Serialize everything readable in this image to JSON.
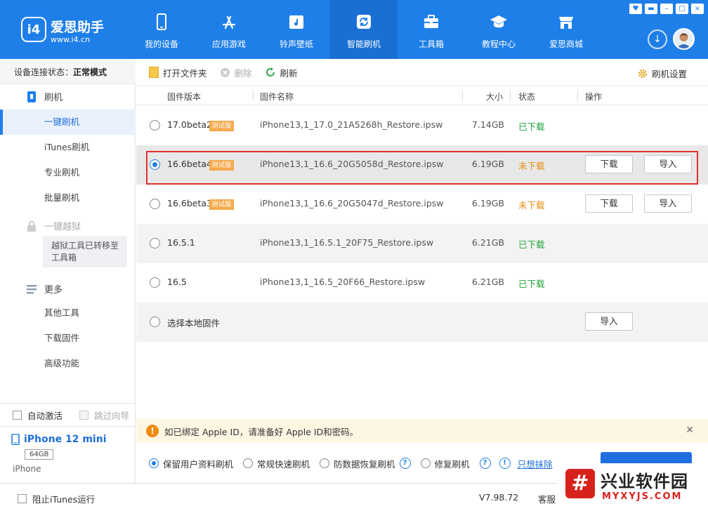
{
  "window": {
    "logo_mark": "i4",
    "app_name": "爱思助手",
    "app_url": "www.i4.cn",
    "controls": [
      "♥",
      "▬",
      "–",
      "□",
      "×"
    ]
  },
  "nav": [
    {
      "label": "我的设备",
      "icon": "phone-icon"
    },
    {
      "label": "应用游戏",
      "icon": "app-store-icon"
    },
    {
      "label": "铃声壁纸",
      "icon": "music-icon"
    },
    {
      "label": "智能刷机",
      "icon": "flash-icon",
      "active": true
    },
    {
      "label": "工具箱",
      "icon": "toolbox-icon"
    },
    {
      "label": "教程中心",
      "icon": "graduation-cap-icon"
    },
    {
      "label": "爱思商城",
      "icon": "shop-icon"
    }
  ],
  "sidebar": {
    "conn_label": "设备连接状态：",
    "conn_value": "正常模式",
    "flash_section": "刷机",
    "items": [
      "一键刷机",
      "iTunes刷机",
      "专业刷机",
      "批量刷机"
    ],
    "jailbreak_section": "一键越狱",
    "jailbreak_note": "越狱工具已转移至工具箱",
    "more_section": "更多",
    "more_items": [
      "其他工具",
      "下载固件",
      "高级功能"
    ],
    "auto_activate": "自动激活",
    "skip_guide": "跳过向导"
  },
  "device": {
    "name": "iPhone 12 mini",
    "storage": "64GB",
    "model": "iPhone"
  },
  "toolbar": {
    "open_folder": "打开文件夹",
    "delete": "删除",
    "refresh": "刷新",
    "settings": "刷机设置"
  },
  "table": {
    "headers": {
      "version": "固件版本",
      "name": "固件名称",
      "size": "大小",
      "status": "状态",
      "action": "操作"
    },
    "rows": [
      {
        "version": "17.0beta2",
        "beta": "测试版",
        "name": "iPhone13,1_17.0_21A5268h_Restore.ipsw",
        "size": "7.14GB",
        "status": "已下载"
      },
      {
        "version": "16.6beta4",
        "beta": "测试版",
        "name": "iPhone13,1_16.6_20G5058d_Restore.ipsw",
        "size": "6.19GB",
        "status": "未下载",
        "download": "下载",
        "import": "导入"
      },
      {
        "version": "16.6beta3",
        "beta": "测试版",
        "name": "iPhone13,1_16.6_20G5047d_Restore.ipsw",
        "size": "6.19GB",
        "status": "未下载",
        "download": "下载",
        "import": "导入"
      },
      {
        "version": "16.5.1",
        "name": "iPhone13,1_16.5.1_20F75_Restore.ipsw",
        "size": "6.21GB",
        "status": "已下载"
      },
      {
        "version": "16.5",
        "name": "iPhone13,1_16.5_20F66_Restore.ipsw",
        "size": "6.21GB",
        "status": "已下载"
      }
    ],
    "local": {
      "label": "选择本地固件",
      "import": "导入"
    }
  },
  "notice": {
    "text": "如已绑定 Apple ID，请准备好 Apple ID和密码。"
  },
  "modes": {
    "keep": "保留用户资料刷机",
    "fast": "常规快速刷机",
    "recovery": "防数据恢复刷机",
    "repair": "修复刷机",
    "erase_link": "只想抹除"
  },
  "status": {
    "block_itunes": "阻止iTunes运行",
    "version": "V7.98.72",
    "service": "客服"
  },
  "watermark": {
    "mark": "#",
    "title": "兴业软件园",
    "url": "MYXYJS.COM"
  },
  "colors": {
    "brand_blue": "#1f7fe8",
    "downloaded_green": "#1fa23b",
    "not_downloaded_orange": "#e68b0c",
    "beta_badge": "#f6a94b",
    "highlight_red": "#e0302c"
  }
}
